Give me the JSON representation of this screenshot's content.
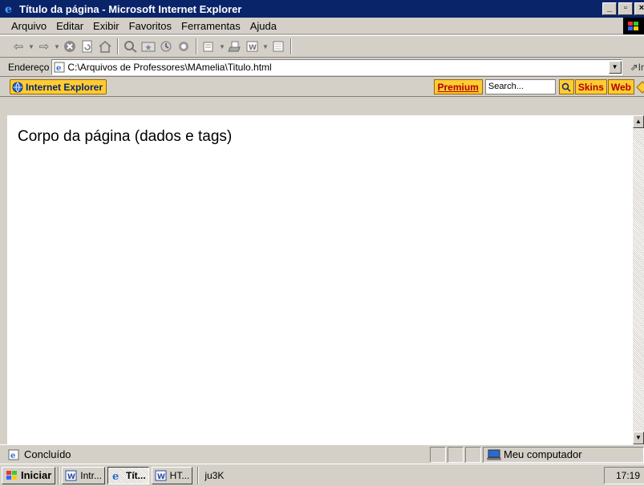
{
  "window": {
    "title": "Título da página - Microsoft Internet Explorer",
    "controls": {
      "minimize": "_",
      "maximize": "▫",
      "close": "×"
    }
  },
  "menubar": {
    "items": [
      "Arquivo",
      "Editar",
      "Exibir",
      "Favoritos",
      "Ferramentas",
      "Ajuda"
    ]
  },
  "toolbar": {
    "buttons": [
      "back-icon",
      "forward-icon",
      "stop-icon",
      "refresh-icon",
      "home-icon",
      "search-icon",
      "favorites-icon",
      "history-icon",
      "mail-icon",
      "print-icon",
      "edit-word-icon",
      "discuss-icon"
    ]
  },
  "address": {
    "label": "Endereço",
    "url": "C:\\Arquivos de Professores\\MAmelia\\Titulo.html",
    "go_label": "Ir"
  },
  "brandbar": {
    "ie_label": "Internet Explorer",
    "premium_label": "Premium",
    "search_placeholder": "Search...",
    "skins_label": "Skins",
    "web_label": "Web"
  },
  "content": {
    "body_text": "Corpo da página (dados e tags)"
  },
  "status": {
    "text": "Concluído",
    "zone": "Meu computador"
  },
  "taskbar": {
    "start_label": "Iniciar",
    "tasks": [
      {
        "label": "Intr...",
        "icon": "word-icon",
        "active": false
      },
      {
        "label": "Tít...",
        "icon": "ie-icon",
        "active": true
      },
      {
        "label": "HT...",
        "icon": "word-icon",
        "active": false
      }
    ],
    "tray_text": "ju3K",
    "clock": "17:19"
  },
  "colors": {
    "titlebar": "#0a246a",
    "chrome": "#d4d0c8",
    "brand_button": "#ffcc33",
    "brand_text": "#b00000"
  }
}
